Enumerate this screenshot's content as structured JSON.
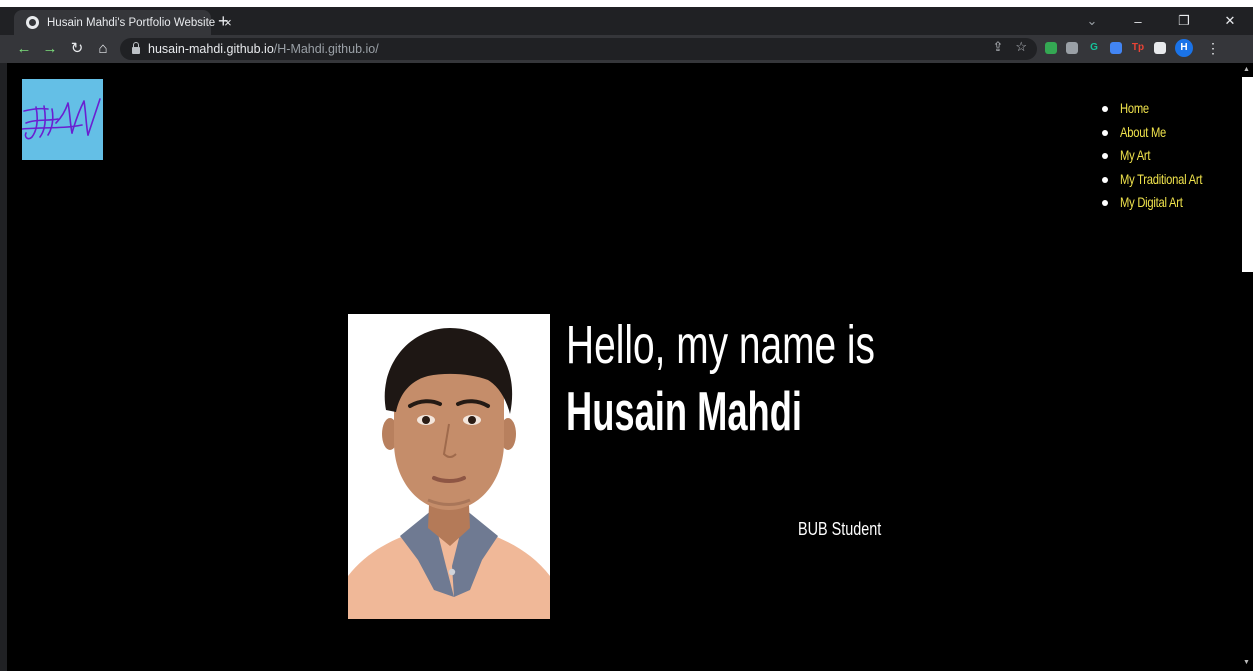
{
  "browser": {
    "tab": {
      "title": "Husain Mahdi's Portfolio Website",
      "close_glyph": "×",
      "favicon_icon": "globe-icon"
    },
    "new_tab_glyph": "+",
    "window_controls": {
      "tab_search_glyph": "⌄",
      "minimize_glyph": "–",
      "maximize_glyph": "❐",
      "close_glyph": "✕"
    },
    "toolbar": {
      "back_glyph": "←",
      "forward_glyph": "→",
      "reload_glyph": "↻",
      "home_glyph": "⌂",
      "url_host": "husain-mahdi.github.io",
      "url_path": "/H-Mahdi.github.io/",
      "share_glyph": "⇪",
      "bookmark_glyph": "☆",
      "extensions": [
        {
          "name": "color-picker-extension-icon",
          "label": "",
          "color": "#34a853"
        },
        {
          "name": "grid-extension-icon",
          "label": "",
          "color": "#9aa0a6"
        },
        {
          "name": "grammarly-extension-icon",
          "label": "G",
          "color": "#15c39a"
        },
        {
          "name": "audio-extension-icon",
          "label": "",
          "color": "#4285f4"
        },
        {
          "name": "tp-extension-icon",
          "label": "Tp",
          "color": "#ea4335"
        },
        {
          "name": "puzzle-extension-icon",
          "label": "",
          "color": "#e8eaed"
        }
      ],
      "profile_initial": "H",
      "menu_glyph": "⋮"
    }
  },
  "page": {
    "nav": [
      {
        "label": "Home"
      },
      {
        "label": "About Me"
      },
      {
        "label": "My Art"
      },
      {
        "label": "My Traditional Art"
      },
      {
        "label": "My Digital Art"
      }
    ],
    "hero": {
      "greeting": "Hello, my name is",
      "name": "Husain Mahdi",
      "subtitle": "BUB Student"
    },
    "colors": {
      "background": "#000000",
      "nav_link": "#f0e34c",
      "logo_background": "#64bfe6",
      "logo_ink": "#6a1fd1"
    }
  }
}
